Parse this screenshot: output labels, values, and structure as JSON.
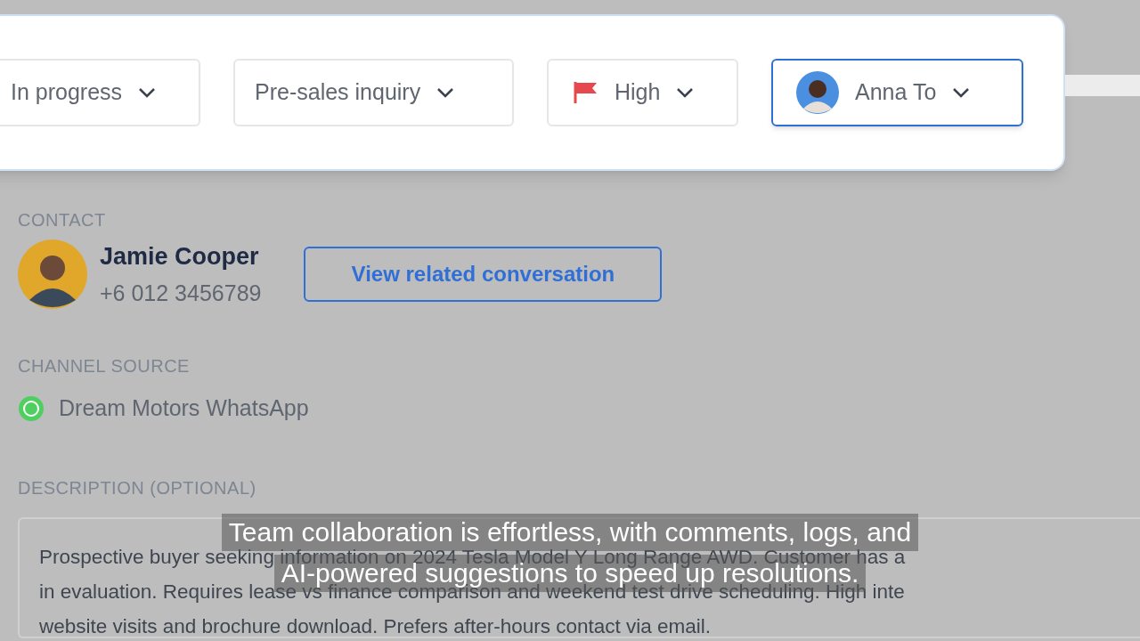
{
  "filters": [
    {
      "kind": "status",
      "label": "In progress",
      "focused": false
    },
    {
      "kind": "category",
      "label": "Pre-sales inquiry",
      "focused": false
    },
    {
      "kind": "priority",
      "label": "High",
      "focused": false
    },
    {
      "kind": "assignee",
      "label": "Anna To",
      "focused": true
    }
  ],
  "contact": {
    "label": "CONTACT",
    "name": "Jamie Cooper",
    "phone": "+6 012 3456789",
    "button": "View related conversation"
  },
  "channel": {
    "label": "CHANNEL SOURCE",
    "value": "Dream Motors WhatsApp"
  },
  "description": {
    "label": "DESCRIPTION (OPTIONAL)",
    "lines": [
      "Prospective buyer seeking information on 2024 Tesla Model Y Long Range AWD. Customer has a",
      "in evaluation. Requires lease vs finance comparison and weekend test drive scheduling. High inte",
      "website visits and brochure download. Prefers after-hours contact via email."
    ]
  },
  "caption": {
    "lines": [
      "Team collaboration is effortless, with comments, logs, and",
      "AI-powered suggestions to speed up resolutions."
    ]
  }
}
